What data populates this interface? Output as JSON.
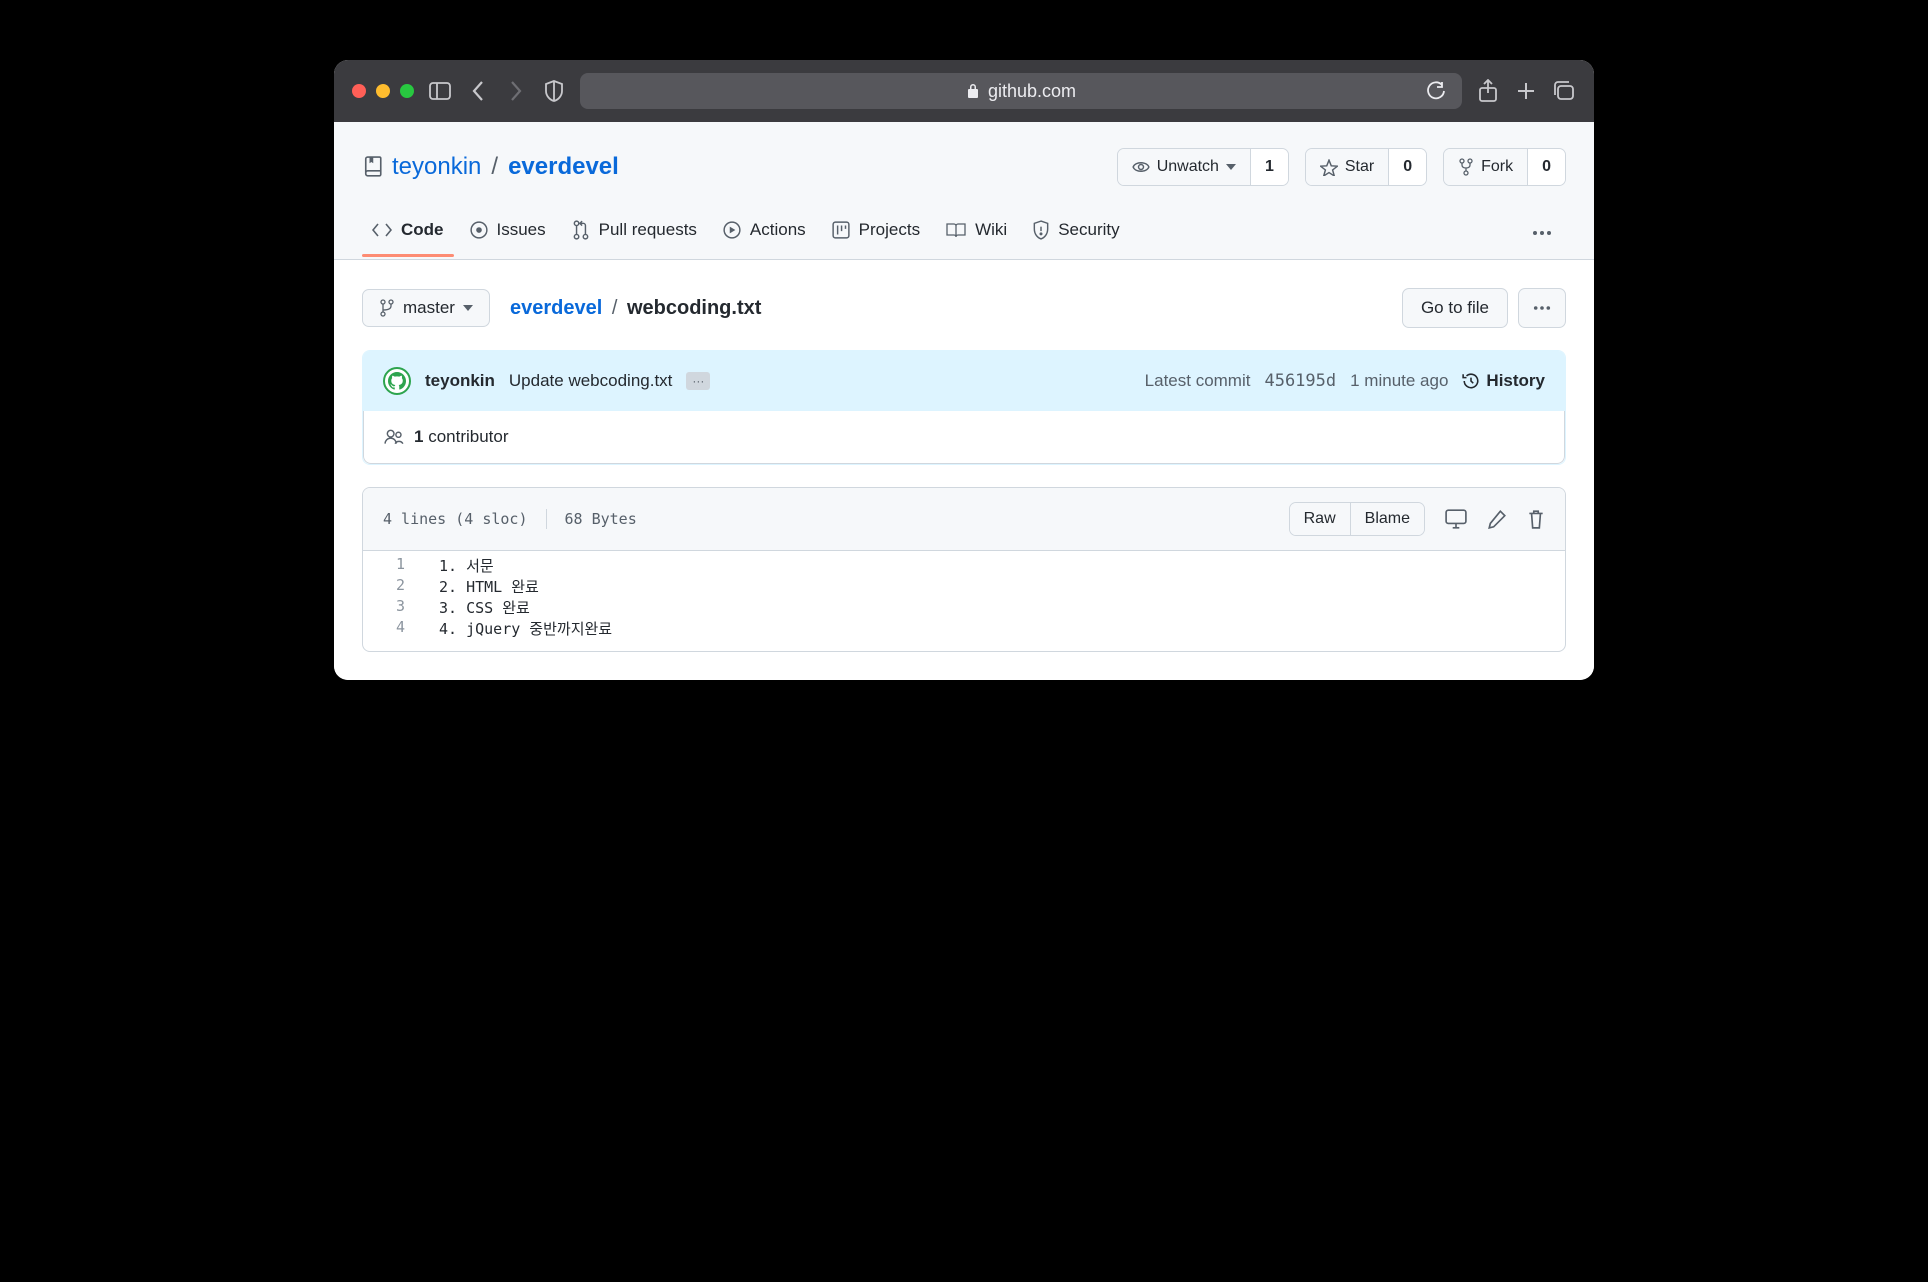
{
  "browser": {
    "url_host": "github.com"
  },
  "repo": {
    "owner": "teyonkin",
    "name": "everdevel",
    "unwatch_label": "Unwatch",
    "unwatch_count": "1",
    "star_label": "Star",
    "star_count": "0",
    "fork_label": "Fork",
    "fork_count": "0"
  },
  "tabs": {
    "code": "Code",
    "issues": "Issues",
    "pulls": "Pull requests",
    "actions": "Actions",
    "projects": "Projects",
    "wiki": "Wiki",
    "security": "Security"
  },
  "file": {
    "branch": "master",
    "breadcrumb_root": "everdevel",
    "breadcrumb_file": "webcoding.txt",
    "goto_label": "Go to file"
  },
  "commit": {
    "author": "teyonkin",
    "message": "Update webcoding.txt",
    "latest_label": "Latest commit",
    "sha": "456195d",
    "ago": "1 minute ago",
    "history_label": "History"
  },
  "contrib": {
    "count": "1",
    "label": "contributor"
  },
  "blob": {
    "stats_lines": "4 lines (4 sloc)",
    "stats_bytes": "68 Bytes",
    "raw_label": "Raw",
    "blame_label": "Blame",
    "lines": [
      {
        "n": "1",
        "t": "1. 서문"
      },
      {
        "n": "2",
        "t": "2. HTML 완료"
      },
      {
        "n": "3",
        "t": "3. CSS 완료"
      },
      {
        "n": "4",
        "t": "4. jQuery 중반까지완료"
      }
    ]
  }
}
